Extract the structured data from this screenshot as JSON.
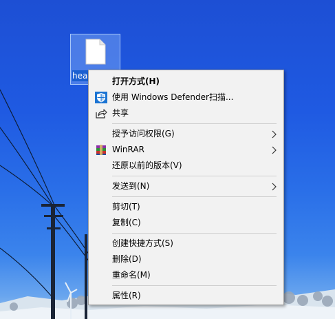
{
  "desktop_file": {
    "name_partial": "hea"
  },
  "context_menu": {
    "items": [
      {
        "label": "打开方式(H)",
        "icon": "",
        "bold": true,
        "submenu": false
      },
      {
        "label": "使用 Windows Defender扫描...",
        "icon": "windows-defender-shield-icon",
        "bold": false,
        "submenu": false
      },
      {
        "label": "共享",
        "icon": "share-icon",
        "bold": false,
        "submenu": false
      },
      {
        "label": "授予访问权限(G)",
        "icon": "",
        "bold": false,
        "submenu": true
      },
      {
        "label": "WinRAR",
        "icon": "winrar-icon",
        "bold": false,
        "submenu": true
      },
      {
        "label": "还原以前的版本(V)",
        "icon": "",
        "bold": false,
        "submenu": false
      },
      {
        "label": "发送到(N)",
        "icon": "",
        "bold": false,
        "submenu": true
      },
      {
        "label": "剪切(T)",
        "icon": "",
        "bold": false,
        "submenu": false
      },
      {
        "label": "复制(C)",
        "icon": "",
        "bold": false,
        "submenu": false
      },
      {
        "label": "创建快捷方式(S)",
        "icon": "",
        "bold": false,
        "submenu": false
      },
      {
        "label": "删除(D)",
        "icon": "",
        "bold": false,
        "submenu": false
      },
      {
        "label": "重命名(M)",
        "icon": "",
        "bold": false,
        "submenu": false
      },
      {
        "label": "属性(R)",
        "icon": "",
        "bold": false,
        "submenu": false
      }
    ]
  },
  "colors": {
    "menu_background": "#f2f2f2",
    "menu_border": "#a0a0a0",
    "separator": "#cfcfcf",
    "defender_blue": "#1b74d3",
    "sky_blue": "#1f5ae2"
  }
}
